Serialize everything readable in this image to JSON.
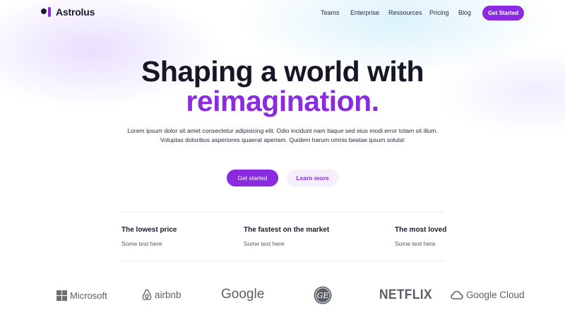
{
  "brand": {
    "name": "Astrolus"
  },
  "nav": {
    "items": [
      {
        "label": "Teams"
      },
      {
        "label": "Enterprise"
      },
      {
        "label": "Ressources"
      },
      {
        "label": "Pricing"
      },
      {
        "label": "Blog"
      }
    ],
    "cta_label": "Get Started"
  },
  "hero": {
    "title_line1": "Shaping a world with",
    "title_accent": "reimagination.",
    "subtitle_line1": "Lorem ipsum dolor sit amet consectetur adipisicing elit. Odio incidunt nam itaque sed eius modi error totam sit illum.",
    "subtitle_line2": "Voluptas doloribus asperiores quaerat aperiam. Quidem harum omnis beatae ipsum soluta!",
    "primary_button": "Get started",
    "secondary_button": "Learn more"
  },
  "features": [
    {
      "title": "The lowest price",
      "text": "Some text here"
    },
    {
      "title": "The fastest on the market",
      "text": "Some text here"
    },
    {
      "title": "The most loved",
      "text": "Some text here"
    }
  ],
  "logos": {
    "microsoft": "Microsoft",
    "airbnb": "airbnb",
    "google": "Google",
    "ge": "GE",
    "netflix": "NETFLIX",
    "google_cloud": "Google Cloud"
  },
  "colors": {
    "accent": "#8a2be2",
    "text": "#1a1b2e",
    "secondary_button_bg": "#f4eefd"
  }
}
